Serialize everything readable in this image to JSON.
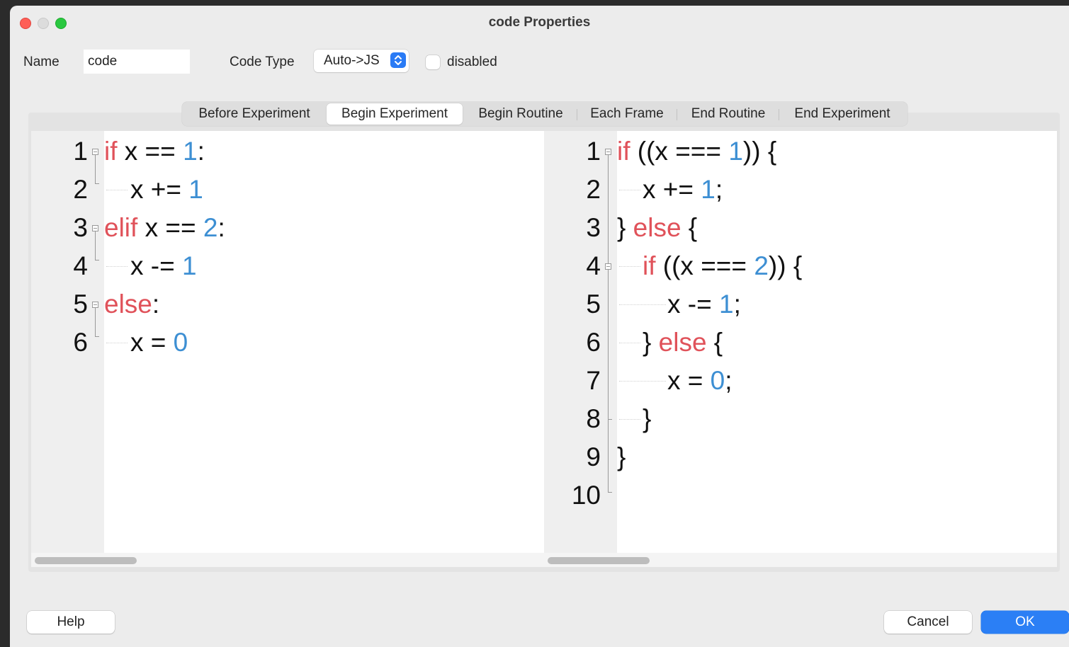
{
  "window": {
    "title": "code Properties"
  },
  "form": {
    "name_label": "Name",
    "name_value": "code",
    "code_type_label": "Code Type",
    "code_type_value": "Auto->JS",
    "disabled_label": "disabled"
  },
  "tabs": [
    {
      "label": "Before Experiment",
      "active": false
    },
    {
      "label": "Begin Experiment",
      "active": true
    },
    {
      "label": "Begin Routine",
      "active": false
    },
    {
      "label": "Each Frame",
      "active": false
    },
    {
      "label": "End Routine",
      "active": false
    },
    {
      "label": "End Experiment",
      "active": false
    }
  ],
  "python_editor": {
    "line_numbers": [
      "1",
      "2",
      "3",
      "4",
      "5",
      "6"
    ]
  },
  "js_editor": {
    "line_numbers": [
      "1",
      "2",
      "3",
      "4",
      "5",
      "6",
      "7",
      "8",
      "9",
      "10"
    ]
  },
  "buttons": {
    "help": "Help",
    "cancel": "Cancel",
    "ok": "OK"
  },
  "colors": {
    "keyword": "#e0525a",
    "number": "#3d8fd3",
    "primary_button": "#2b7ff5"
  }
}
